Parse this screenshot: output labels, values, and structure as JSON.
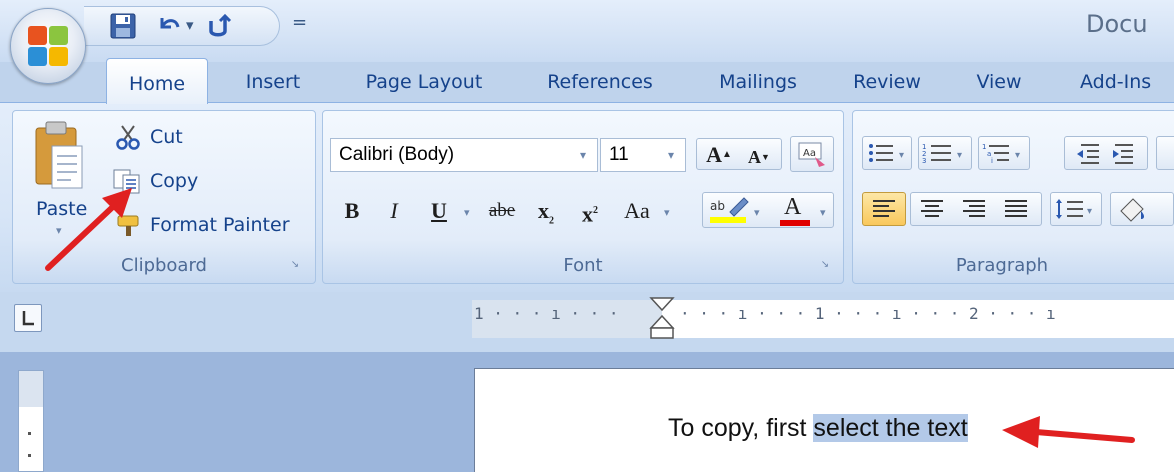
{
  "window": {
    "title_partial": "Docu"
  },
  "quick_access": {
    "save_icon": "save-icon",
    "undo_icon": "undo-icon",
    "redo_icon": "redo-icon",
    "customize_glyph": "="
  },
  "tabs": [
    "Home",
    "Insert",
    "Page Layout",
    "References",
    "Mailings",
    "Review",
    "View",
    "Add-Ins"
  ],
  "clipboard": {
    "paste_label": "Paste",
    "cut_label": "Cut",
    "copy_label": "Copy",
    "format_painter_label": "Format Painter",
    "group_label": "Clipboard"
  },
  "font": {
    "family_value": "Calibri (Body)",
    "size_value": "11",
    "group_label": "Font",
    "bold": "B",
    "italic": "I",
    "underline": "U",
    "strikethrough": "abe",
    "subscript": "x",
    "superscript": "x",
    "change_case": "Aa",
    "grow_font": "A",
    "shrink_font": "A",
    "font_color": "A"
  },
  "paragraph": {
    "group_label": "Paragraph"
  },
  "ruler": {
    "left_marks": "1 · · · ı · · ·",
    "right_marks": "· · · ı · · · 1 · · · ı · · · 2 · · · ı"
  },
  "document": {
    "text_before": "To copy, first ",
    "text_selected": "select the text"
  },
  "colors": {
    "accent": "#15428b",
    "arrow": "#e02020",
    "selection": "#b3c9e8",
    "highlight_yellow": "#ffff00",
    "font_color_red": "#e00000"
  }
}
